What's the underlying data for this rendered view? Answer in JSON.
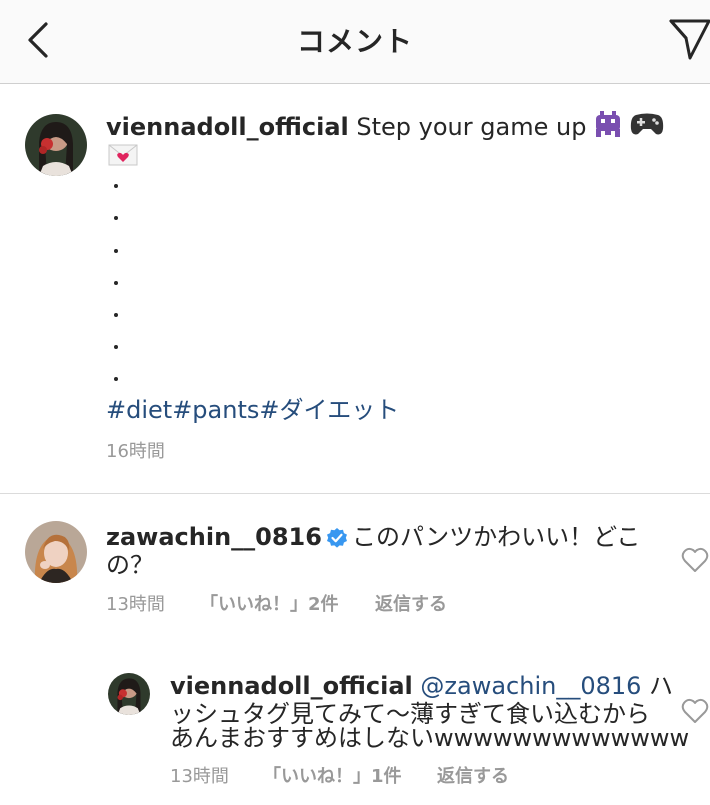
{
  "header": {
    "title": "コメント"
  },
  "post": {
    "username": "viennadoll_official",
    "caption": " Step your game up ",
    "emojis": [
      "alien-monster-emoji",
      "game-controller-emoji",
      "love-letter-emoji"
    ],
    "dots": [
      ".",
      ".",
      ".",
      ".",
      ".",
      ".",
      "."
    ],
    "hashtags": [
      "#diet",
      "#pants",
      "#ダイエット"
    ],
    "time": "16時間"
  },
  "comments": [
    {
      "username": "zawachin__0816",
      "verified": true,
      "text_line1": "このパンツかわいい！どこ",
      "text_line2": "の？",
      "time": "13時間",
      "likes": "「いいね！」2件",
      "reply_label": "返信する"
    }
  ],
  "replies": [
    {
      "username": "viennadoll_official",
      "mention": "@zawachin__0816",
      "text_line1_tail": " ハ",
      "text_line2": "ッシュタグ見てみて〜薄すぎて食い込むから",
      "text_line3": "あんまおすすめはしないwwwwwwwwwwwww",
      "time": "13時間",
      "likes": "「いいね！」1件",
      "reply_label": "返信する"
    }
  ],
  "icons": {
    "back": "chevron-left-icon",
    "send": "paper-plane-icon",
    "like": "heart-outline-icon",
    "verified": "verified-badge-icon"
  },
  "colors": {
    "text": "#262626",
    "muted": "#999999",
    "link": "#264d7c",
    "verified": "#3897f0",
    "header_bg": "#fafafa"
  }
}
